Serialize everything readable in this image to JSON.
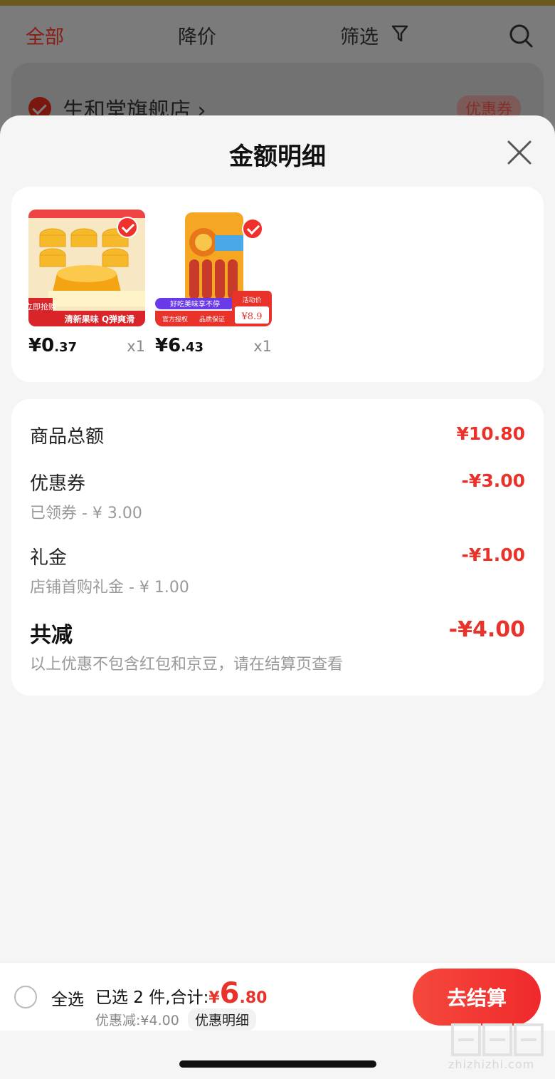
{
  "background": {
    "tabs": [
      "全部",
      "降价",
      "筛选"
    ],
    "store_name": "生和堂旗舰店 ›",
    "coupon_badge": "优惠券"
  },
  "sheet": {
    "title": "金额明细",
    "products": [
      {
        "price_int": "¥0",
        "price_dec": ".37",
        "qty": "x1",
        "image_text": {
          "promo": "立即抢购",
          "slogan": "清新果味 Q弹爽滑"
        }
      },
      {
        "price_int": "¥6",
        "price_dec": ".43",
        "qty": "x1",
        "image_text": {
          "banner": "好吃美味享不停",
          "tag1": "官方授权",
          "tag2": "品质保证",
          "activity": "活动价",
          "activity_price": "¥8.9"
        }
      }
    ],
    "summary": {
      "goods_total_label": "商品总额",
      "goods_total_value": "¥10.80",
      "coupon_label": "优惠券",
      "coupon_sub": "已领券 - ¥ 3.00",
      "coupon_value": "-¥3.00",
      "gift_label": "礼金",
      "gift_sub": "店铺首购礼金 - ¥ 1.00",
      "gift_value": "-¥1.00",
      "total_reduce_label": "共减",
      "total_reduce_value": "-¥4.00",
      "note": "以上优惠不包含红包和京豆，请在结算页查看"
    }
  },
  "bottom_bar": {
    "select_all": "全选",
    "selected_prefix": "已选 2 件,合计:",
    "total_symbol": "¥",
    "total_main": "6",
    "total_dec": ".80",
    "discount": "优惠减:¥4.00",
    "detail_link": "优惠明细",
    "checkout": "去结算"
  },
  "watermark": "zhizhizhi.com",
  "colors": {
    "accent_red": "#e8322a",
    "checkout_gradient_start": "#f5493c",
    "checkout_gradient_end": "#f0292c"
  }
}
